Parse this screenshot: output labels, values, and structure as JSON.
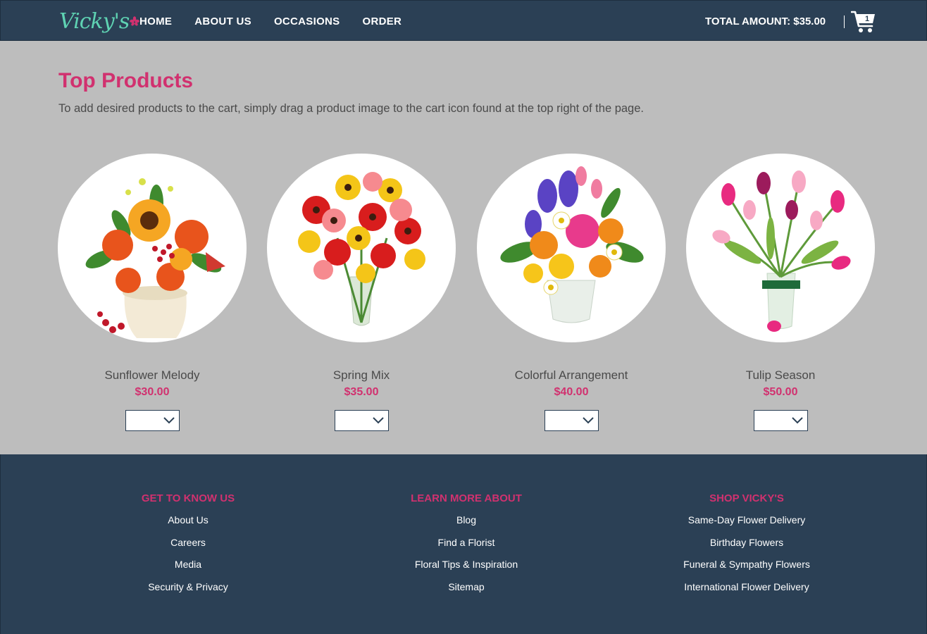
{
  "brand": {
    "logo_text": "Vicky's",
    "accent_color": "#d1316f",
    "header_color": "#2b4055",
    "logo_color": "#5fd3b3"
  },
  "nav": {
    "items": [
      "HOME",
      "ABOUT US",
      "OCCASIONS",
      "ORDER"
    ]
  },
  "cart": {
    "total_label": "TOTAL AMOUNT: $35.00",
    "count": "1",
    "icon": "cart-icon"
  },
  "main": {
    "title": "Top Products",
    "subtitle": "To add desired products to the cart, simply drag a product image to the cart icon found at the top right of the page."
  },
  "products": [
    {
      "name": "Sunflower Melody",
      "price": "$30.00",
      "quantity": ""
    },
    {
      "name": "Spring Mix",
      "price": "$35.00",
      "quantity": ""
    },
    {
      "name": "Colorful Arrangement",
      "price": "$40.00",
      "quantity": ""
    },
    {
      "name": "Tulip Season",
      "price": "$50.00",
      "quantity": ""
    }
  ],
  "footer": {
    "columns": [
      {
        "heading": "GET TO KNOW US",
        "links": [
          "About Us",
          "Careers",
          "Media",
          "Security & Privacy"
        ]
      },
      {
        "heading": "LEARN MORE ABOUT",
        "links": [
          "Blog",
          "Find a Florist",
          "Floral Tips & Inspiration",
          "Sitemap"
        ]
      },
      {
        "heading": "SHOP VICKY'S",
        "links": [
          "Same-Day Flower Delivery",
          "Birthday Flowers",
          "Funeral & Sympathy Flowers",
          "International Flower Delivery"
        ]
      }
    ]
  }
}
